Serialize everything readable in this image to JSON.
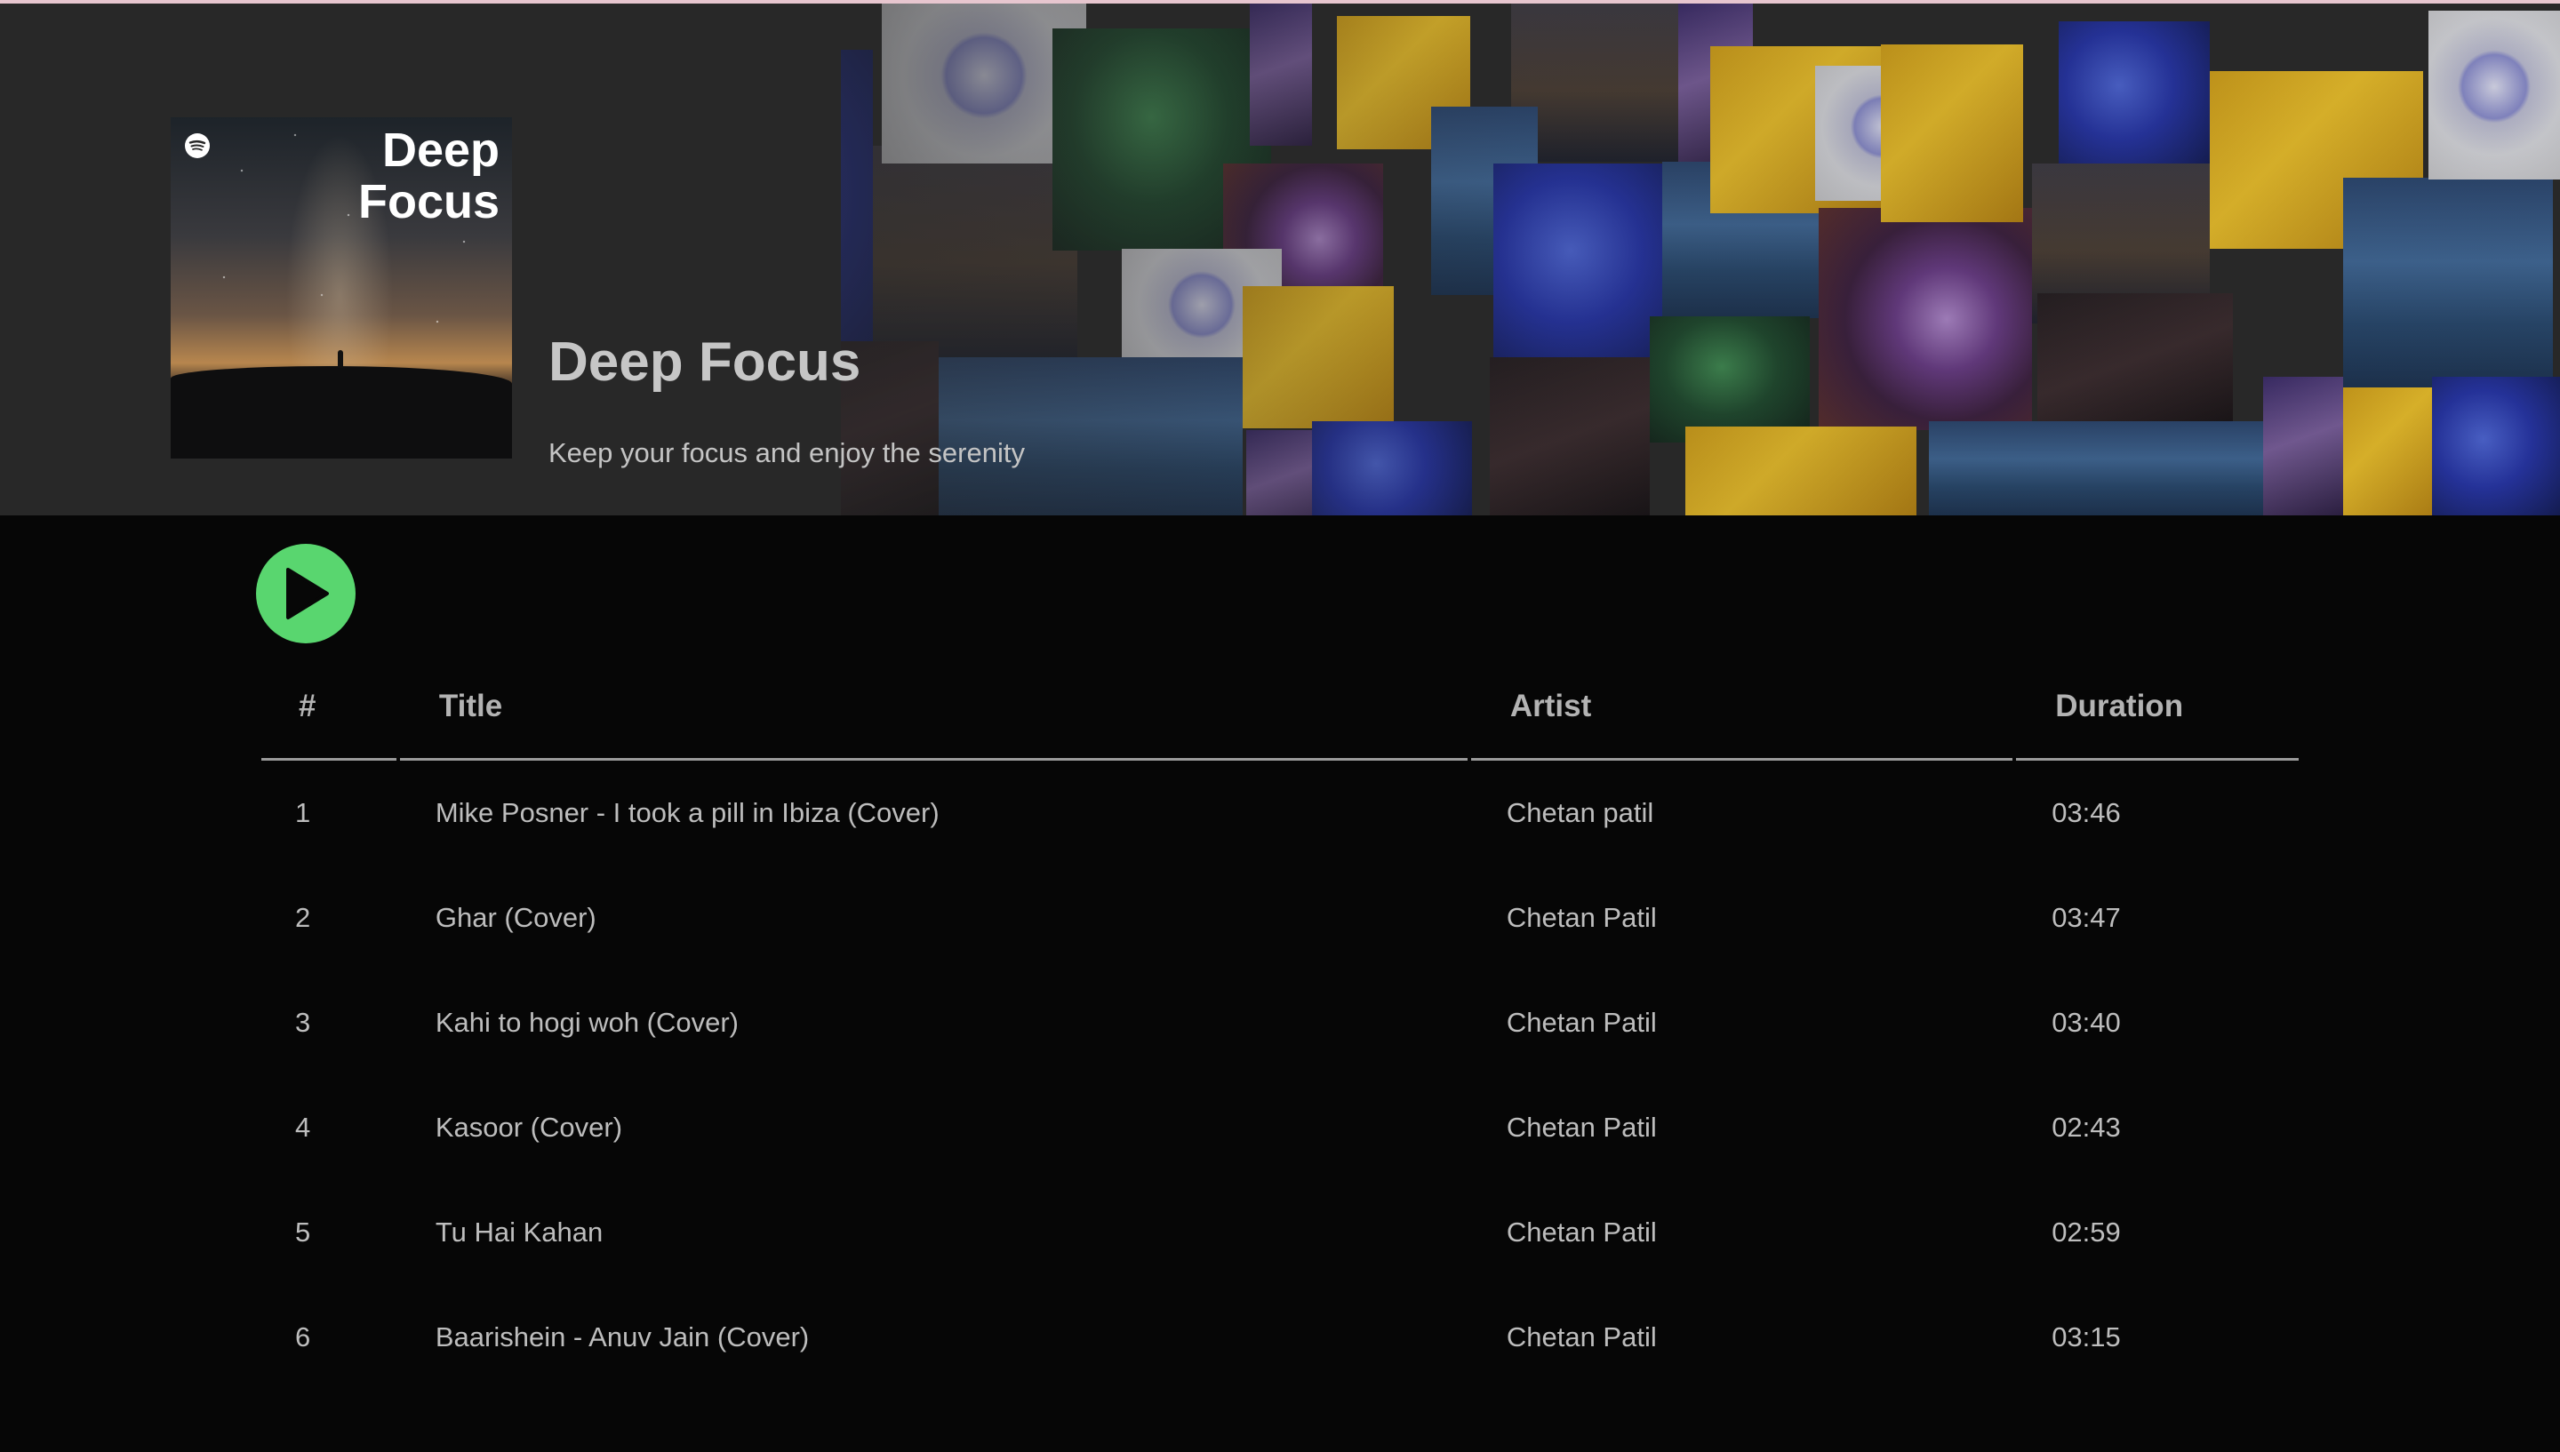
{
  "playlist": {
    "cover_title": "Deep Focus",
    "title": "Deep Focus",
    "description": "Keep your focus and enjoy the serenity",
    "cover_logo_icon": "spotify-logo-icon"
  },
  "controls": {
    "play_icon": "play-icon",
    "play_color": "#59d66f"
  },
  "table": {
    "headers": {
      "number": "#",
      "title": "Title",
      "artist": "Artist",
      "duration": "Duration"
    },
    "rows": [
      {
        "number": "1",
        "title": "Mike Posner - I took a pill in Ibiza (Cover)",
        "artist": "Chetan patil",
        "duration": "03:46"
      },
      {
        "number": "2",
        "title": "Ghar (Cover)",
        "artist": "Chetan Patil",
        "duration": "03:47"
      },
      {
        "number": "3",
        "title": "Kahi to hogi woh (Cover)",
        "artist": "Chetan Patil",
        "duration": "03:40"
      },
      {
        "number": "4",
        "title": "Kasoor (Cover)",
        "artist": "Chetan Patil",
        "duration": "02:43"
      },
      {
        "number": "5",
        "title": "Tu Hai Kahan",
        "artist": "Chetan Patil",
        "duration": "02:59"
      },
      {
        "number": "6",
        "title": "Baarishein - Anuv Jain (Cover)",
        "artist": "Chetan Patil",
        "duration": "03:15"
      }
    ]
  }
}
